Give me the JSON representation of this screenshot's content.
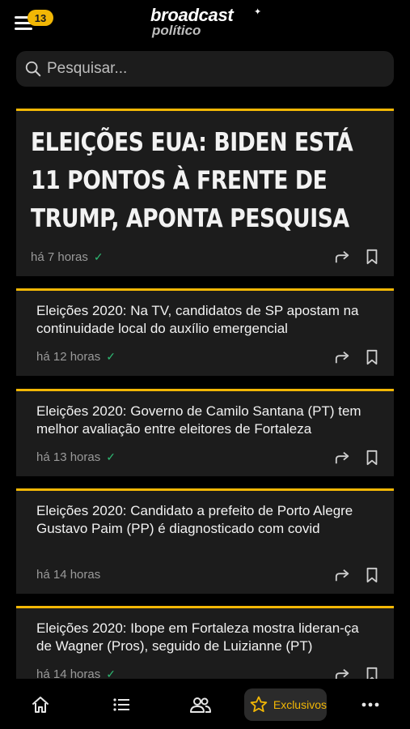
{
  "header": {
    "notification_count": "13",
    "logo_main": "broadcast",
    "logo_sub": "político"
  },
  "search": {
    "placeholder": "Pesquisar..."
  },
  "headline": {
    "title": "ELEIÇÕES EUA: BIDEN ESTÁ 11 PONTOS À FRENTE DE TRUMP, APONTA PESQUISA",
    "time": "há 7 horas",
    "read": true
  },
  "articles": [
    {
      "title": "Eleições 2020: Na TV, candidatos de SP apostam na continuidade local do auxílio emergencial",
      "time": "há 12 horas",
      "read": true
    },
    {
      "title": "Eleições 2020: Governo de Camilo Santana (PT) tem melhor avaliação entre eleitores de Fortaleza",
      "time": "há 13 horas",
      "read": true
    },
    {
      "title": "Eleições 2020: Candidato a prefeito de Porto Alegre Gustavo Paim (PP) é diagnosticado com covid",
      "time": "há 14 horas",
      "read": false
    },
    {
      "title": "Eleições 2020: Ibope em Fortaleza mostra lideran-ça de Wagner (Pros), seguido de Luizianne (PT)",
      "time": "há 14 horas",
      "read": true
    }
  ],
  "nav": {
    "items": [
      "home-icon",
      "list-icon",
      "users-icon",
      "star-icon",
      "more-icon"
    ],
    "active_label": "Exclusivos"
  },
  "colors": {
    "accent": "#f2b705",
    "background": "#000000",
    "card": "#1c1c1c",
    "read_check": "#2eb872"
  }
}
